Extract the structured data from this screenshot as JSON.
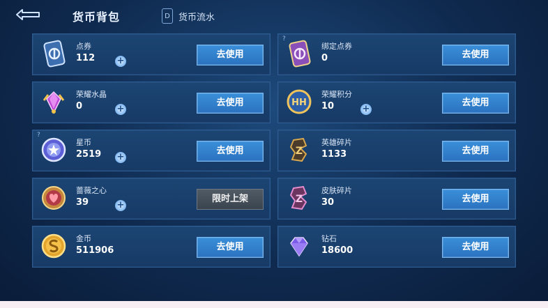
{
  "header": {
    "title": "货币背包",
    "flow_label": "货币流水",
    "flow_icon": "D"
  },
  "currencies_left": [
    {
      "name": "点券",
      "amount": "112",
      "has_plus": true,
      "has_info": false,
      "button": "去使用",
      "button_type": "use",
      "icon": "ticket-card-icon"
    },
    {
      "name": "荣耀水晶",
      "amount": "0",
      "has_plus": true,
      "has_info": false,
      "button": "去使用",
      "button_type": "use",
      "icon": "glory-crystal-icon"
    },
    {
      "name": "星币",
      "amount": "2519",
      "has_plus": true,
      "has_info": true,
      "button": "去使用",
      "button_type": "use",
      "icon": "star-coin-icon"
    },
    {
      "name": "蔷薇之心",
      "amount": "39",
      "has_plus": true,
      "has_info": false,
      "button": "限时上架",
      "button_type": "limited",
      "icon": "rose-heart-icon"
    },
    {
      "name": "金币",
      "amount": "511906",
      "has_plus": false,
      "has_info": false,
      "button": "去使用",
      "button_type": "use",
      "icon": "gold-coin-icon"
    }
  ],
  "currencies_right": [
    {
      "name": "绑定点券",
      "amount": "0",
      "has_plus": false,
      "has_info": true,
      "button": "去使用",
      "button_type": "use",
      "icon": "bound-ticket-icon"
    },
    {
      "name": "荣耀积分",
      "amount": "10",
      "has_plus": true,
      "has_info": false,
      "button": "去使用",
      "button_type": "use",
      "icon": "glory-points-icon"
    },
    {
      "name": "英雄碎片",
      "amount": "1133",
      "has_plus": false,
      "has_info": false,
      "button": "去使用",
      "button_type": "use",
      "icon": "hero-fragment-icon"
    },
    {
      "name": "皮肤碎片",
      "amount": "30",
      "has_plus": false,
      "has_info": false,
      "button": "去使用",
      "button_type": "use",
      "icon": "skin-fragment-icon"
    },
    {
      "name": "钻石",
      "amount": "18600",
      "has_plus": false,
      "has_info": false,
      "button": "去使用",
      "button_type": "use",
      "icon": "diamond-icon"
    }
  ],
  "plus_symbol": "+",
  "info_symbol": "?",
  "colors": {
    "accent": "#2b72c0",
    "card_bg": "#173a66",
    "limited_bg": "#3b444e"
  }
}
